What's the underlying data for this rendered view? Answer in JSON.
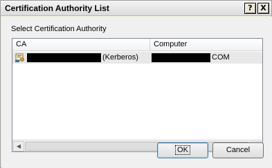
{
  "window": {
    "title": "Certification Authority List",
    "help_glyph": "?",
    "close_glyph": "X"
  },
  "prompt": "Select Certification Authority",
  "list": {
    "columns": [
      "CA",
      "Computer"
    ],
    "rows": [
      {
        "ca_suffix": "(Kerberos)",
        "computer_suffix": "COM"
      }
    ]
  },
  "scrollbar": {
    "left_arrow": "◀",
    "right_arrow": "▶"
  },
  "buttons": {
    "ok": "OK",
    "cancel": "Cancel"
  }
}
